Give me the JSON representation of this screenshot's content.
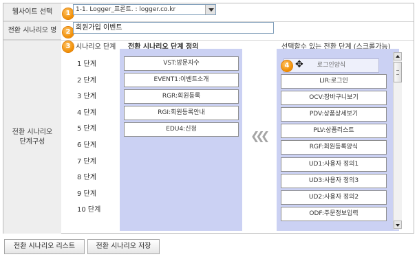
{
  "form": {
    "website_label": "웹사이트 선택",
    "website_value": "1-1. Logger_프론트. : logger.co.kr",
    "scenario_name_label": "전환 시나리오 명",
    "scenario_name_value": "회원가입 이벤트",
    "config_label_line1": "전환 시나리오",
    "config_label_line2": "단계구성"
  },
  "badges": [
    "1",
    "2",
    "3",
    "4"
  ],
  "headers": {
    "steps": "시나리오 단계",
    "definition": "전환 시나리오 단계 정의",
    "available": "선택할수 있는 전환 단계 (스크롤가능)"
  },
  "steps": [
    "1 단계",
    "2 단계",
    "3 단계",
    "4 단계",
    "5 단계",
    "6 단계",
    "7 단계",
    "8 단계",
    "9 단계",
    "10 단계"
  ],
  "defined_steps": [
    "VST:방문자수",
    "EVENT1:이벤트소개",
    "RGR:회원등록",
    "RGI:회원등록안내",
    "EDU4:신청"
  ],
  "available_steps": [
    "로그인양식",
    "LIR:로그인",
    "OCV:장바구니보기",
    "PDV:상품상세보기",
    "PLV:상품리스트",
    "RGF:회원등록양식",
    "UD1:사용자 정의1",
    "UD3:사용자 정의3",
    "UD2:사용자 정의2",
    "ODF:주문정보입력"
  ],
  "buttons": {
    "list": "전환 시나리오 리스트",
    "save": "전환 시나리오 저장"
  },
  "icons": {
    "move_arrows": "double-chevron-left-icon",
    "drag_cursor": "move-cursor-icon"
  }
}
